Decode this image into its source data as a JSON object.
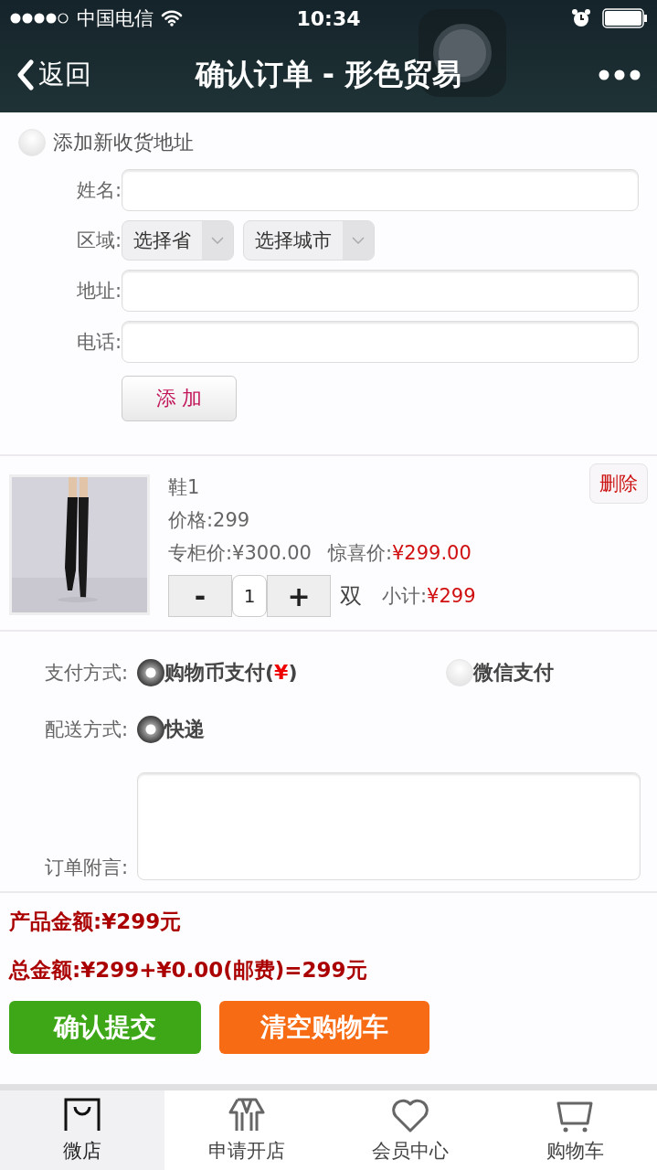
{
  "status_bar": {
    "carrier": "中国电信",
    "time": "10:34"
  },
  "nav": {
    "back": "返回",
    "title": "确认订单 - 形色贸易"
  },
  "address_form": {
    "toggle": {
      "label": "添加新收货地址",
      "selected": false
    },
    "fields": [
      {
        "kind": "text",
        "label": "姓名:"
      },
      {
        "kind": "selects",
        "label": "区域:",
        "options": [
          "选择省",
          "选择城市"
        ]
      },
      {
        "kind": "text",
        "label": "地址:"
      },
      {
        "kind": "text",
        "label": "电话:"
      }
    ],
    "submit": "添 加"
  },
  "cart_item": {
    "name": "鞋1",
    "price": "价格:299",
    "counter_price_label": "专柜价:",
    "counter_price": "¥300.00",
    "surprise_price_label": "惊喜价:",
    "surprise_price": "¥299.00",
    "minus": "-",
    "quantity": "1",
    "plus": "+",
    "unit": "双",
    "subtotal_label": "小计:",
    "subtotal": "¥299",
    "delete": "删除"
  },
  "payment": {
    "label": "支付方式:",
    "options": [
      {
        "label_before": "购物币支付(",
        "mark": "¥",
        "label_after": ")",
        "selected": true
      },
      {
        "label_before": "微信支付",
        "selected": false
      }
    ]
  },
  "delivery": {
    "label": "配送方式:",
    "options": [
      {
        "label_before": "快递",
        "selected": true
      }
    ]
  },
  "note": {
    "label": "订单附言:"
  },
  "totals": {
    "product_amount": "产品金额:¥299元",
    "total_amount": "总金额:¥299+¥0.00(邮费)=299元"
  },
  "actions": [
    {
      "kind": "confirm",
      "label": "确认提交"
    },
    {
      "kind": "clear",
      "label": "清空购物车"
    }
  ],
  "tab_bar": [
    {
      "kind": "shop",
      "label": "微店",
      "selected": true
    },
    {
      "kind": "apply",
      "label": "申请开店",
      "selected": false
    },
    {
      "kind": "member",
      "label": "会员中心",
      "selected": false
    },
    {
      "kind": "cart",
      "label": "购物车",
      "selected": false
    }
  ]
}
